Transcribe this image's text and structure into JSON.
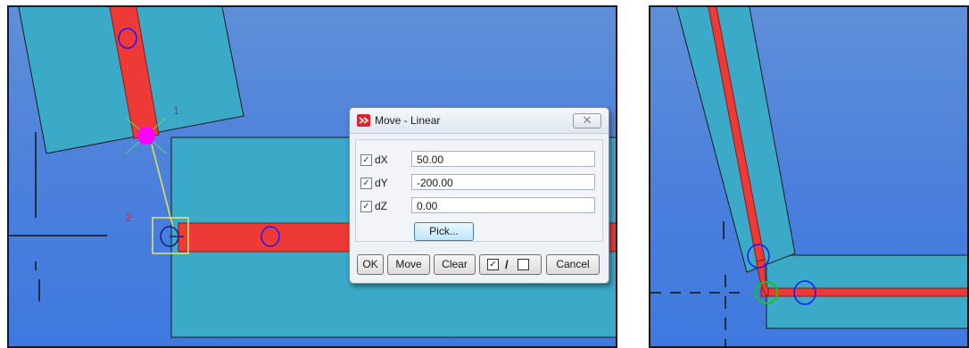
{
  "viewport_left": {
    "markers": [
      {
        "label": "1"
      },
      {
        "label": "2"
      }
    ]
  },
  "dialog": {
    "title": "Move - Linear",
    "close_glyph": "⨉",
    "fields": [
      {
        "label": "dX",
        "value": "50.00",
        "checked": true
      },
      {
        "label": "dY",
        "value": "-200.00",
        "checked": true
      },
      {
        "label": "dZ",
        "value": "0.00",
        "checked": true
      }
    ],
    "pick_label": "Pick...",
    "buttons": {
      "ok": "OK",
      "move": "Move",
      "clear": "Clear",
      "toggle_separator": "/",
      "cancel": "Cancel"
    }
  },
  "colors": {
    "background_blue": "#4a7fdc",
    "plate_teal": "#3ba9c8",
    "pipe_red": "#ee3a36",
    "handle_magenta": "#ff00ff",
    "circle_blue": "#1a1aff",
    "circle_green": "#19c31a",
    "label_red": "#e02020"
  },
  "icons": [
    "app-icon",
    "close-icon",
    "checkbox-icon"
  ]
}
